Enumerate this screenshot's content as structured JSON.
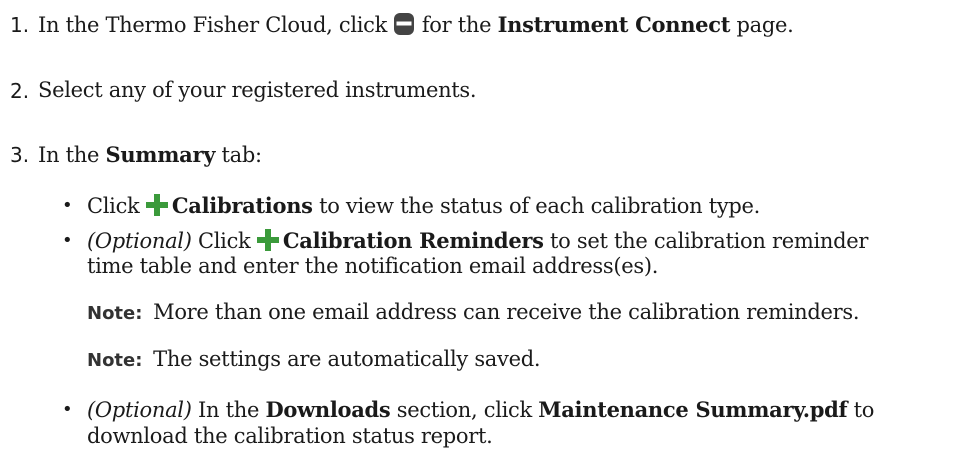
{
  "steps": [
    {
      "number": "1.",
      "text_pre": "In the Thermo Fisher Cloud, click ",
      "icon": "instrument-connect-icon",
      "text_mid": " for the ",
      "bold": "Instrument Connect",
      "text_post": " page."
    },
    {
      "number": "2.",
      "text": "Select any of your registered instruments."
    },
    {
      "number": "3.",
      "text_pre": "In the ",
      "bold": "Summary",
      "text_post": " tab:"
    }
  ],
  "bullets": [
    {
      "text_pre": "Click ",
      "icon": "plus-icon",
      "bold": "Calibrations",
      "text_post": " to view the status of each calibration type."
    },
    {
      "optional": "(Optional)",
      "text_pre": " Click ",
      "icon": "plus-icon",
      "bold": "Calibration Reminders",
      "text_post": " to set the calibration reminder",
      "line2": "time table and enter the notification email address(es)."
    },
    {
      "optional": "(Optional)",
      "text_pre": " In the ",
      "bold": "Downloads",
      "text_mid": " section, click ",
      "bold2": "Maintenance Summary.pdf",
      "text_post": " to",
      "line2": "download the calibration status report."
    }
  ],
  "notes": [
    {
      "label": "Note:",
      "text": "More than one email address can receive the calibration reminders."
    },
    {
      "label": "Note:",
      "text": "The settings are automatically saved."
    }
  ],
  "bullet_char": "•"
}
